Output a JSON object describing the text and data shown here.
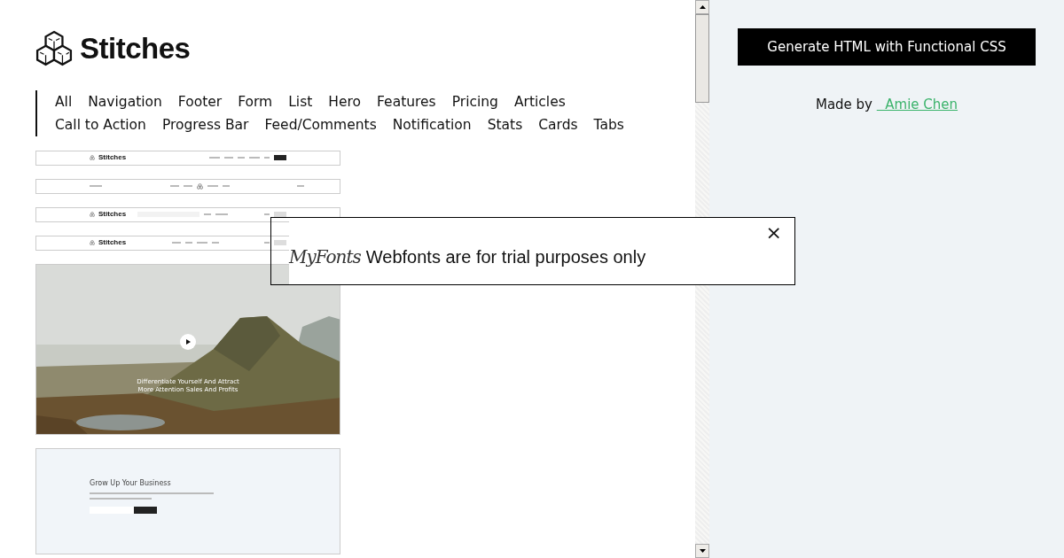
{
  "brand": {
    "name": "Stitches"
  },
  "categories": [
    {
      "label": "All"
    },
    {
      "label": "Navigation"
    },
    {
      "label": "Footer"
    },
    {
      "label": "Form"
    },
    {
      "label": "List"
    },
    {
      "label": "Hero"
    },
    {
      "label": "Features"
    },
    {
      "label": "Pricing"
    },
    {
      "label": "Articles"
    },
    {
      "label": "Call to Action"
    },
    {
      "label": "Progress Bar"
    },
    {
      "label": "Feed/Comments"
    },
    {
      "label": "Notification"
    },
    {
      "label": "Stats"
    },
    {
      "label": "Cards"
    },
    {
      "label": "Tabs"
    }
  ],
  "previews": [
    {
      "kind": "nav",
      "logo": "Stitches"
    },
    {
      "kind": "nav-center"
    },
    {
      "kind": "nav-search",
      "logo": "Stitches"
    },
    {
      "kind": "nav-plain",
      "logo": "Stitches"
    },
    {
      "kind": "hero",
      "heading": "Differentiate Yourself And Attract More Attention Sales And Profits"
    },
    {
      "kind": "form",
      "heading": "Grow Up Your Business"
    }
  ],
  "generate_button": "Generate HTML with Functional CSS",
  "credit": {
    "text": "Made by",
    "link": "  Amie Chen"
  },
  "notice": {
    "logo": "MyFonts",
    "text": "Webfonts are for trial purposes only",
    "close": "×"
  }
}
